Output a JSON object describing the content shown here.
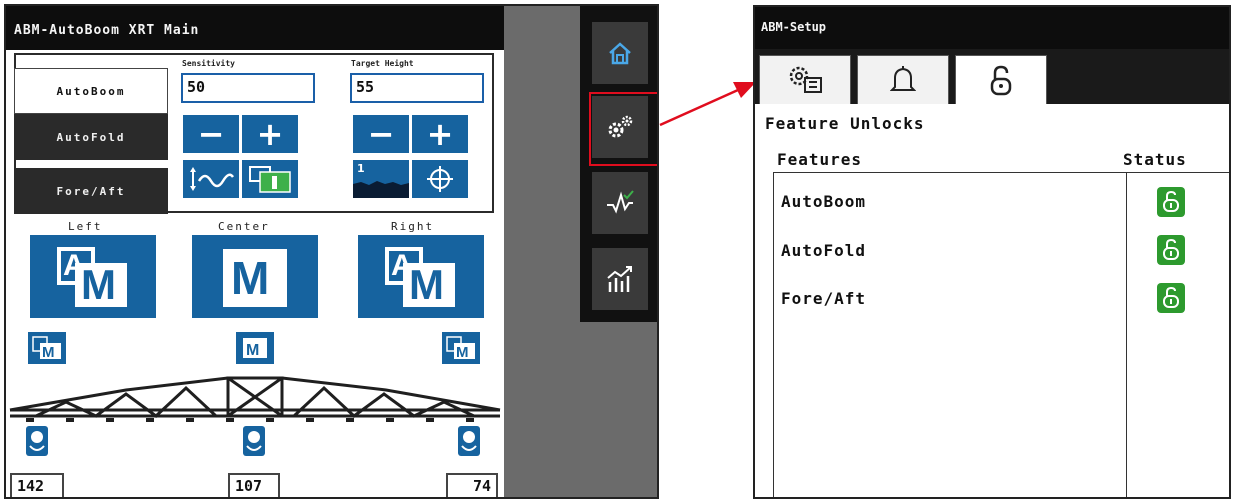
{
  "main": {
    "title": "ABM-AutoBoom XRT Main",
    "tabs": [
      "AutoBoom",
      "AutoFold",
      "Fore/Aft"
    ],
    "sensitivity_label": "Sensitivity",
    "sensitivity_value": "50",
    "target_height_label": "Target Height",
    "target_height_value": "55",
    "minus_symbol": "−",
    "plus_symbol": "+",
    "preset_level": "1",
    "sections": {
      "left": "Left",
      "center": "Center",
      "right": "Right"
    },
    "readings": {
      "left": "142",
      "center": "107",
      "right": "74"
    }
  },
  "side_nav": {
    "items": [
      "home-icon",
      "settings-gears-icon",
      "diagnostics-icon",
      "statistics-chart-icon"
    ],
    "highlight_color": "#e00d1e",
    "accent_color": "#16639f"
  },
  "setup": {
    "title": "ABM-Setup",
    "tabs": [
      "machine-settings-icon",
      "bell-icon",
      "lock-icon"
    ],
    "active_tab": "lock-icon",
    "heading": "Feature Unlocks",
    "col_features": "Features",
    "col_status": "Status",
    "features": [
      {
        "name": "AutoBoom",
        "status": "unlocked"
      },
      {
        "name": "AutoFold",
        "status": "unlocked"
      },
      {
        "name": "Fore/Aft",
        "status": "unlocked"
      }
    ],
    "unlock_color": "#2d9a2e"
  }
}
